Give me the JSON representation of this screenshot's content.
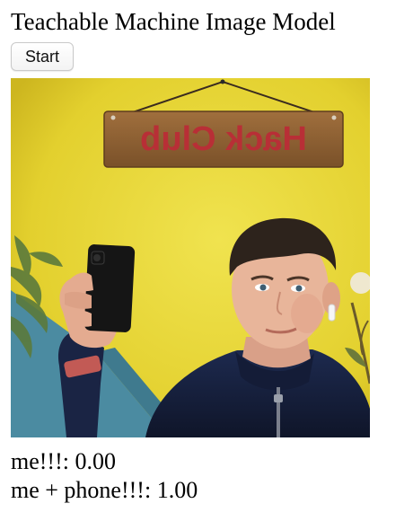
{
  "page": {
    "title": "Teachable Machine Image Model",
    "start_button_label": "Start"
  },
  "webcam": {
    "sign_text": "Hack Club",
    "colors": {
      "wall": "#eddc43",
      "panel": "#4f8fa4",
      "sign_wood": "#8b5f35",
      "sign_text": "#b82f36",
      "hoodie": "#17203d",
      "skin": "#e8b59a",
      "hair": "#2d231c",
      "phone": "#151515"
    }
  },
  "predictions": [
    {
      "label": "me!!!",
      "value": "0.00"
    },
    {
      "label": "me + phone!!!",
      "value": "1.00"
    }
  ]
}
